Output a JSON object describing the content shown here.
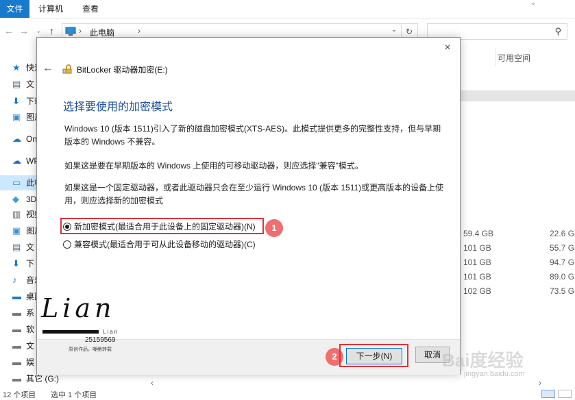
{
  "ribbon": {
    "tabs": [
      "文件",
      "计算机",
      "查看"
    ]
  },
  "address": {
    "path": "此电脑",
    "path_sep": "›"
  },
  "nav": {
    "items": [
      {
        "label": "快速",
        "icon": "star-icon"
      },
      {
        "label": "文",
        "icon": "document-icon"
      },
      {
        "label": "下载",
        "icon": "download-icon"
      },
      {
        "label": "图片",
        "icon": "picture-icon"
      },
      {
        "label": "OneDrive",
        "icon": "cloud-icon"
      },
      {
        "label": "WPS",
        "icon": "wps-cloud-icon"
      },
      {
        "label": "此电",
        "icon": "computer-icon"
      },
      {
        "label": "3D",
        "icon": "cube-icon"
      },
      {
        "label": "视频",
        "icon": "video-icon"
      },
      {
        "label": "图片",
        "icon": "picture-icon"
      },
      {
        "label": "文",
        "icon": "document-icon"
      },
      {
        "label": "下",
        "icon": "download-icon"
      },
      {
        "label": "音乐",
        "icon": "music-icon"
      },
      {
        "label": "桌面",
        "icon": "desktop-icon"
      },
      {
        "label": "系",
        "icon": "drive-icon"
      },
      {
        "label": "软",
        "icon": "drive-icon"
      },
      {
        "label": "文",
        "icon": "drive-icon"
      },
      {
        "label": "娱",
        "icon": "drive-icon"
      },
      {
        "label": "其它 (G:)",
        "icon": "drive-icon"
      }
    ]
  },
  "columns": {
    "free_space_header": "可用空间"
  },
  "drives": [
    {
      "total": "59.4 GB",
      "free": "22.6 G"
    },
    {
      "total": "101 GB",
      "free": "55.7 G"
    },
    {
      "total": "101 GB",
      "free": "94.7 G"
    },
    {
      "total": "101 GB",
      "free": "89.0 G"
    },
    {
      "total": "102 GB",
      "free": "73.5 G"
    }
  ],
  "status": {
    "count": "12 个项目",
    "selected": "选中 1 个项目"
  },
  "dialog": {
    "title": "BitLocker 驱动器加密(E:)",
    "heading": "选择要使用的加密模式",
    "para1": "Windows 10 (版本 1511)引入了新的磁盘加密模式(XTS-AES)。此模式提供更多的完整性支持，但与早期版本的 Windows 不兼容。",
    "para2": "如果这是要在早期版本的 Windows 上使用的可移动驱动器，则应选择\"兼容\"模式。",
    "para3": "如果这是一个固定驱动器，或者此驱动器只会在至少运行 Windows 10 (版本 1511)或更高版本的设备上使用，则应选择新的加密模式",
    "option_new": "新加密模式(最适合用于此设备上的固定驱动器)(N)",
    "option_compat": "兼容模式(最适合用于可从此设备移动的驱动器)(C)",
    "selected": "new",
    "next_label": "下一步(N)",
    "cancel_label": "取消",
    "close_glyph": "×",
    "back_glyph": "←"
  },
  "annotations": {
    "badge1": "1",
    "badge2": "2"
  },
  "watermark": {
    "name": "Lian",
    "sub": "Lian",
    "number": "25159569",
    "note": "原创作品，嘲绝转载",
    "baidu": "Bai度经验",
    "baidu_url": "jingyan.baidu.com"
  },
  "colors": {
    "accent": "#1979ca",
    "highlight": "#e0313a",
    "heading": "#1c4f9c"
  }
}
